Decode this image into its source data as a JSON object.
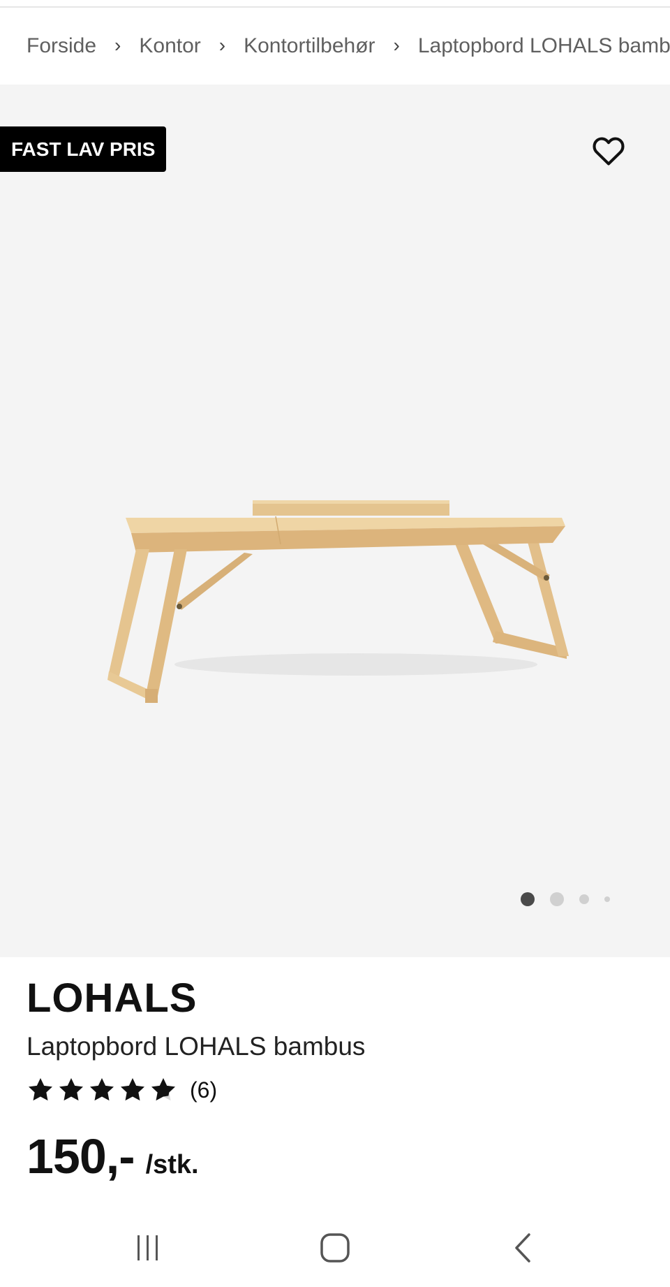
{
  "breadcrumb": {
    "items": [
      "Forside",
      "Kontor",
      "Kontortilbehør",
      "Laptopbord LOHALS bambus"
    ],
    "separator": "›"
  },
  "gallery": {
    "badge": "FAST LAV PRIS",
    "favorite_icon": "heart-outline-icon",
    "image_count": 4,
    "active_index": 0,
    "background": "#f4f4f4"
  },
  "product": {
    "brand": "LOHALS",
    "name": "Laptopbord LOHALS bambus",
    "rating": 4.5,
    "rating_max": 5,
    "review_count": "(6)",
    "price": "150,-",
    "unit": "/stk."
  },
  "system_nav": {
    "icons": [
      "recent-apps-icon",
      "home-icon",
      "back-icon"
    ]
  },
  "colors": {
    "text": "#111111",
    "badge_bg": "#000000",
    "wood": "#e8c892",
    "muted": "#5f5f5f"
  }
}
